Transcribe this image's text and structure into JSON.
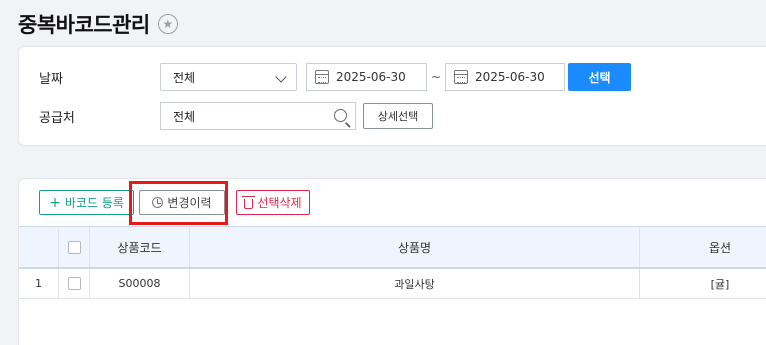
{
  "header": {
    "title": "중복바코드관리",
    "favorite_icon": "star-icon"
  },
  "filters": {
    "date_label": "날짜",
    "date_type": "전체",
    "date_from": "2025-06-30",
    "date_sep": "~",
    "date_to": "2025-06-30",
    "select_button": "선택",
    "supplier_label": "공급처",
    "supplier_placeholder": "전체",
    "detail_button": "상세선택"
  },
  "toolbar": {
    "add_label": "바코드 등록",
    "history_label": "변경이력",
    "delete_label": "선택삭제"
  },
  "table": {
    "columns": [
      "상품코드",
      "상품명",
      "옵션"
    ],
    "rows": [
      {
        "index": "1",
        "code": "S00008",
        "name": "과일사탕",
        "option": "[귤]"
      }
    ]
  },
  "colors": {
    "accent": "#1a8cff",
    "add": "#1c9b8a",
    "delete": "#e0284c",
    "highlight": "#e51b1b"
  }
}
